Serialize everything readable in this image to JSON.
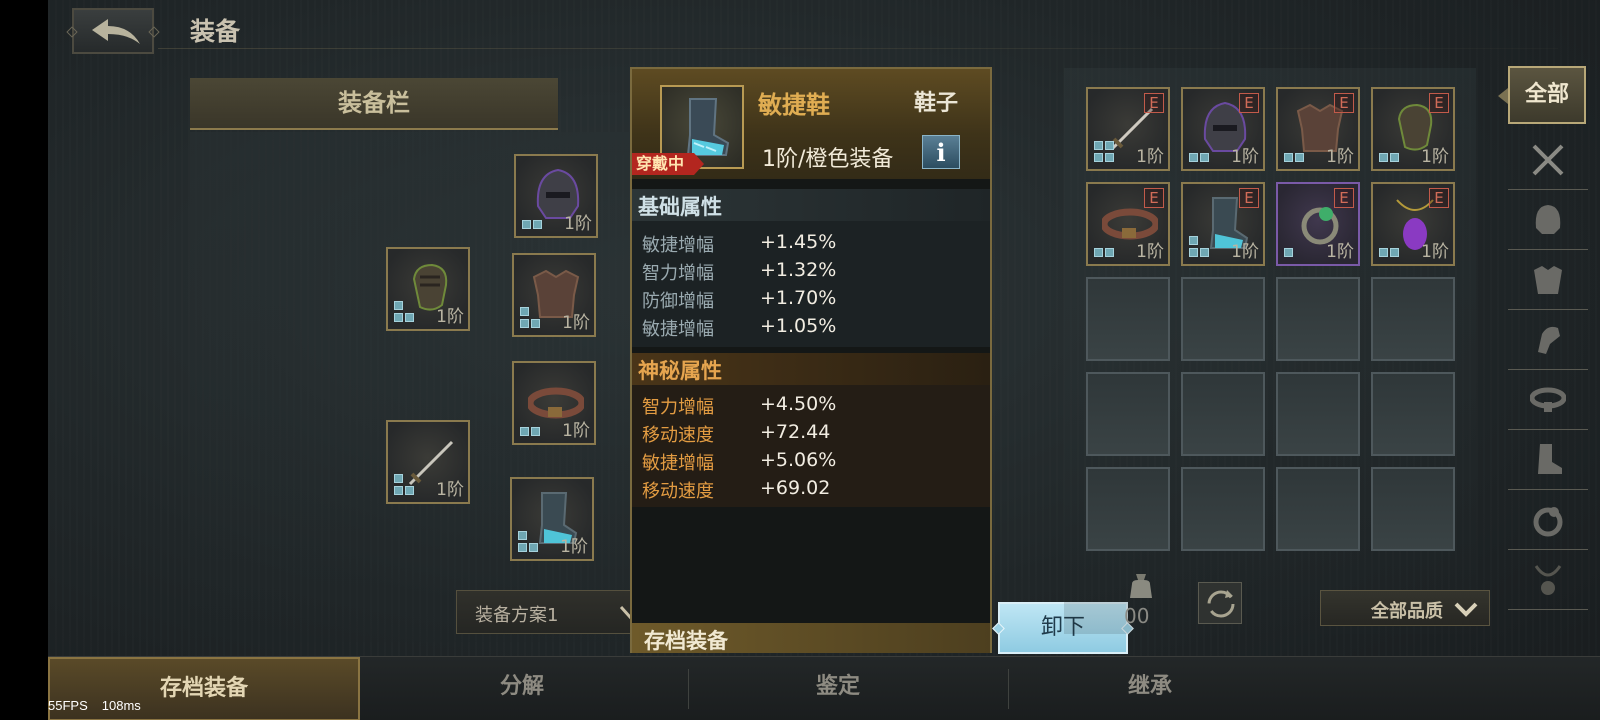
{
  "header": {
    "title": "装备"
  },
  "slots_panel": {
    "title": "装备栏",
    "scheme": "装备方案1"
  },
  "equipped_slots": [
    {
      "tier": "1阶",
      "item": "helmet-icon"
    },
    {
      "tier": "1阶",
      "item": "gauntlet-icon"
    },
    {
      "tier": "1阶",
      "item": "chest-armor-icon"
    },
    {
      "tier": "1阶",
      "item": "belt-icon"
    },
    {
      "tier": "1阶",
      "item": "sword-icon"
    },
    {
      "tier": "1阶",
      "item": "boots-icon"
    }
  ],
  "tooltip": {
    "name": "敏捷鞋",
    "type": "鞋子",
    "quality": "1阶/橙色装备",
    "wearing": "穿戴中",
    "base_title": "基础属性",
    "base_attrs": [
      {
        "k": "敏捷增幅",
        "v": "+1.45%"
      },
      {
        "k": "智力增幅",
        "v": "+1.32%"
      },
      {
        "k": "防御增幅",
        "v": "+1.70%"
      },
      {
        "k": "敏捷增幅",
        "v": "+1.05%"
      }
    ],
    "mystic_title": "神秘属性",
    "mystic_attrs": [
      {
        "k": "智力增幅",
        "v": "+4.50%"
      },
      {
        "k": "移动速度",
        "v": "+72.44"
      },
      {
        "k": "敏捷增幅",
        "v": "+5.06%"
      },
      {
        "k": "移动速度",
        "v": "+69.02"
      }
    ],
    "footer": "存档装备"
  },
  "unequip_label": "卸下",
  "inventory": {
    "items": [
      {
        "tier": "1阶",
        "badge": "E",
        "item": "sword-icon"
      },
      {
        "tier": "1阶",
        "badge": "E",
        "item": "helmet-icon"
      },
      {
        "tier": "1阶",
        "badge": "E",
        "item": "chest-armor-icon"
      },
      {
        "tier": "1阶",
        "badge": "E",
        "item": "gauntlet-icon"
      },
      {
        "tier": "1阶",
        "badge": "E",
        "item": "belt-icon"
      },
      {
        "tier": "1阶",
        "badge": "E",
        "item": "boots-icon"
      },
      {
        "tier": "1阶",
        "badge": "E",
        "item": "ring-icon"
      },
      {
        "tier": "1阶",
        "badge": "E",
        "item": "amulet-icon"
      }
    ],
    "bag_count": "00",
    "quality_filter": "全部品质"
  },
  "categories": {
    "all": "全部",
    "icons": [
      "crossed-swords-icon",
      "helmet-icon",
      "armor-icon",
      "gauntlet-icon",
      "belt-icon",
      "boots-icon",
      "ring-icon",
      "necklace-icon"
    ]
  },
  "bottom_tabs": [
    "存档装备",
    "分解",
    "鉴定",
    "继承"
  ],
  "debug": {
    "fps": "55FPS",
    "latency": "108ms"
  },
  "colors": {
    "gold": "#e0ad52",
    "mystic": "#e39c42",
    "accent_button": "#bfe6f4"
  }
}
